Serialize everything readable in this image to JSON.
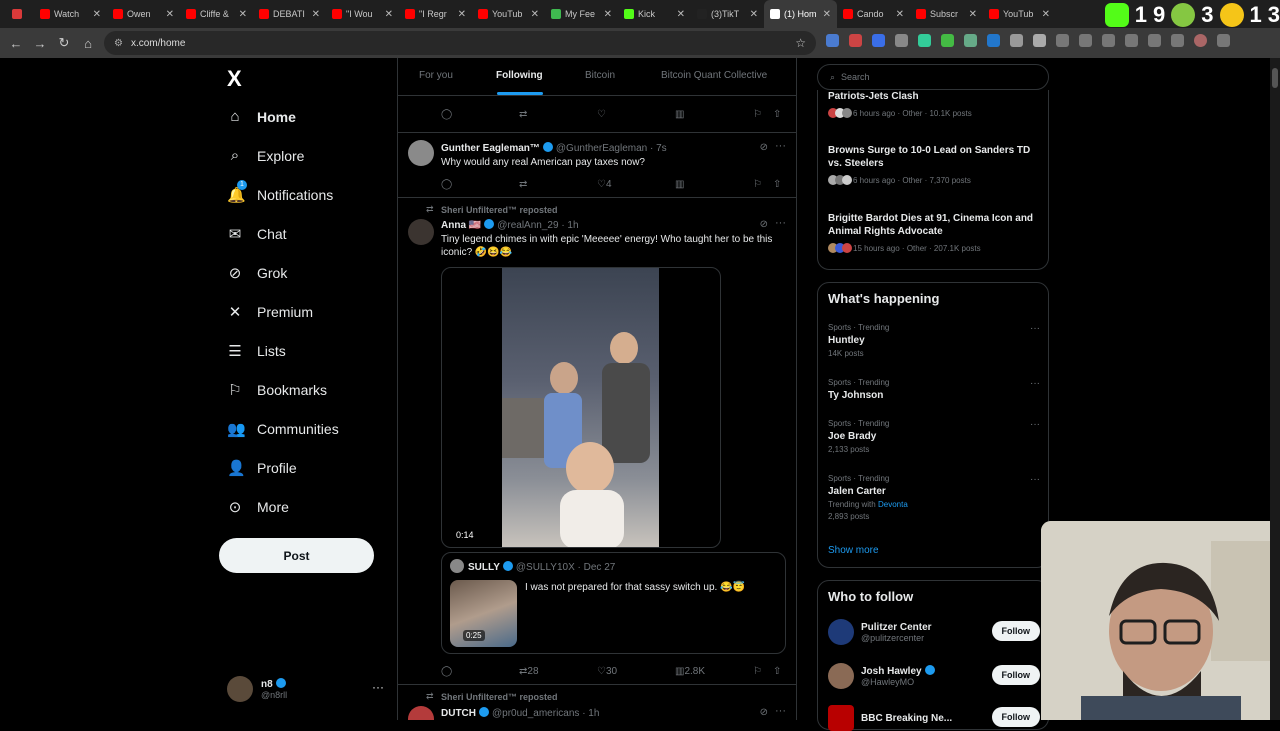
{
  "browser": {
    "tabs": [
      {
        "title": "",
        "color": "#d93a3a"
      },
      {
        "title": "Watch",
        "color": "#ff0000"
      },
      {
        "title": "Owen",
        "color": "#ff0000"
      },
      {
        "title": "Cliffe &",
        "color": "#ff0000"
      },
      {
        "title": "DEBATI",
        "color": "#ff0000"
      },
      {
        "title": "\"I Wou",
        "color": "#ff0000"
      },
      {
        "title": "\"I Regr",
        "color": "#ff0000"
      },
      {
        "title": "YouTub",
        "color": "#ff0000"
      },
      {
        "title": "My Fee",
        "color": "#3fb950"
      },
      {
        "title": "Kick",
        "color": "#53fc18"
      },
      {
        "title": "(3)TikT",
        "color": "#222222"
      },
      {
        "title": "(1) Hom",
        "color": "#ffffff"
      },
      {
        "title": "Cando",
        "color": "#ff0000"
      },
      {
        "title": "Subscr",
        "color": "#ff0000"
      },
      {
        "title": "YouTub",
        "color": "#ff0000"
      }
    ],
    "url": "x.com/home",
    "overlay_counter": [
      "1",
      "9",
      "3",
      "1",
      "3"
    ]
  },
  "leftnav": {
    "logo": "X",
    "items": [
      {
        "label": "Home",
        "icon": "home-icon",
        "glyph": "⌂"
      },
      {
        "label": "Explore",
        "icon": "search-icon",
        "glyph": "⌕"
      },
      {
        "label": "Notifications",
        "icon": "bell-icon",
        "glyph": "🔔"
      },
      {
        "label": "Chat",
        "icon": "mail-icon",
        "glyph": "✉"
      },
      {
        "label": "Grok",
        "icon": "grok-icon",
        "glyph": "⊘"
      },
      {
        "label": "Premium",
        "icon": "x-premium-icon",
        "glyph": "✕"
      },
      {
        "label": "Lists",
        "icon": "list-icon",
        "glyph": "☰"
      },
      {
        "label": "Bookmarks",
        "icon": "bookmark-icon",
        "glyph": "⚐"
      },
      {
        "label": "Communities",
        "icon": "people-icon",
        "glyph": "👥"
      },
      {
        "label": "Profile",
        "icon": "person-icon",
        "glyph": "👤"
      },
      {
        "label": "More",
        "icon": "more-circle-icon",
        "glyph": "⊙"
      }
    ],
    "notif_badge": "1",
    "post_label": "Post",
    "account": {
      "name": "n8",
      "handle": "@n8rll"
    }
  },
  "feed": {
    "tabs": [
      "For you",
      "Following",
      "Bitcoin",
      "Bitcoin Quant Collective"
    ],
    "tweet1": {
      "name": "Gunther Eagleman™",
      "handle": "@GuntherEagleman · 7s",
      "text": "Why would any real American pay taxes now?",
      "likes": "4"
    },
    "tweet2": {
      "repost_label": "Sheri Unfiltered™ reposted",
      "name": "Anna 🇺🇸",
      "handle": "@realAnn_29 · 1h",
      "text": "Tiny legend chimes in with epic 'Meeeee' energy! Who taught her to be this iconic? 🤣😆😂",
      "video_time": "0:14",
      "quote": {
        "name": "SULLY",
        "handle": "@SULLY10X · Dec 27",
        "text": "I was not prepared for that sassy switch up. 😂😇",
        "video_time": "0:25"
      },
      "replies": "",
      "reposts": "28",
      "likes": "30",
      "views": "2.8K"
    },
    "tweet3": {
      "repost_label": "Sheri Unfiltered™ reposted",
      "name": "DUTCH",
      "handle": "@pr0ud_americans · 1h"
    }
  },
  "right": {
    "search_placeholder": "Search",
    "news": [
      {
        "title": "Patriots-Jets Clash",
        "meta": "6 hours ago · Other · 10.1K posts"
      },
      {
        "title": "Browns Surge to 10-0 Lead on Sanders TD vs. Steelers",
        "meta": "6 hours ago · Other · 7,370 posts"
      },
      {
        "title": "Brigitte Bardot Dies at 91, Cinema Icon and Animal Rights Advocate",
        "meta": "15 hours ago · Other · 207.1K posts"
      }
    ],
    "whats_happening": "What's happening",
    "trends": [
      {
        "category": "Sports · Trending",
        "name": "Huntley",
        "posts": "14K posts",
        "with_prefix": "",
        "with": ""
      },
      {
        "category": "Sports · Trending",
        "name": "Ty Johnson",
        "posts": "",
        "with_prefix": "",
        "with": ""
      },
      {
        "category": "Sports · Trending",
        "name": "Joe Brady",
        "posts": "2,133 posts",
        "with_prefix": "",
        "with": ""
      },
      {
        "category": "Sports · Trending",
        "name": "Jalen Carter",
        "posts": "2,893 posts",
        "with_prefix": "Trending with",
        "with": "Devonta"
      }
    ],
    "show_more": "Show more",
    "who_to_follow": "Who to follow",
    "follow": [
      {
        "name": "Pulitzer Center",
        "handle": "@pulitzercenter",
        "btn": "Follow"
      },
      {
        "name": "Josh Hawley",
        "handle": "@HawleyMO",
        "btn": "Follow"
      },
      {
        "name": "BBC Breaking Ne...",
        "handle": "",
        "btn": "Follow"
      }
    ]
  },
  "colors": {
    "accent": "#1d9bf0",
    "bg": "#000000",
    "border": "#2f3336"
  }
}
